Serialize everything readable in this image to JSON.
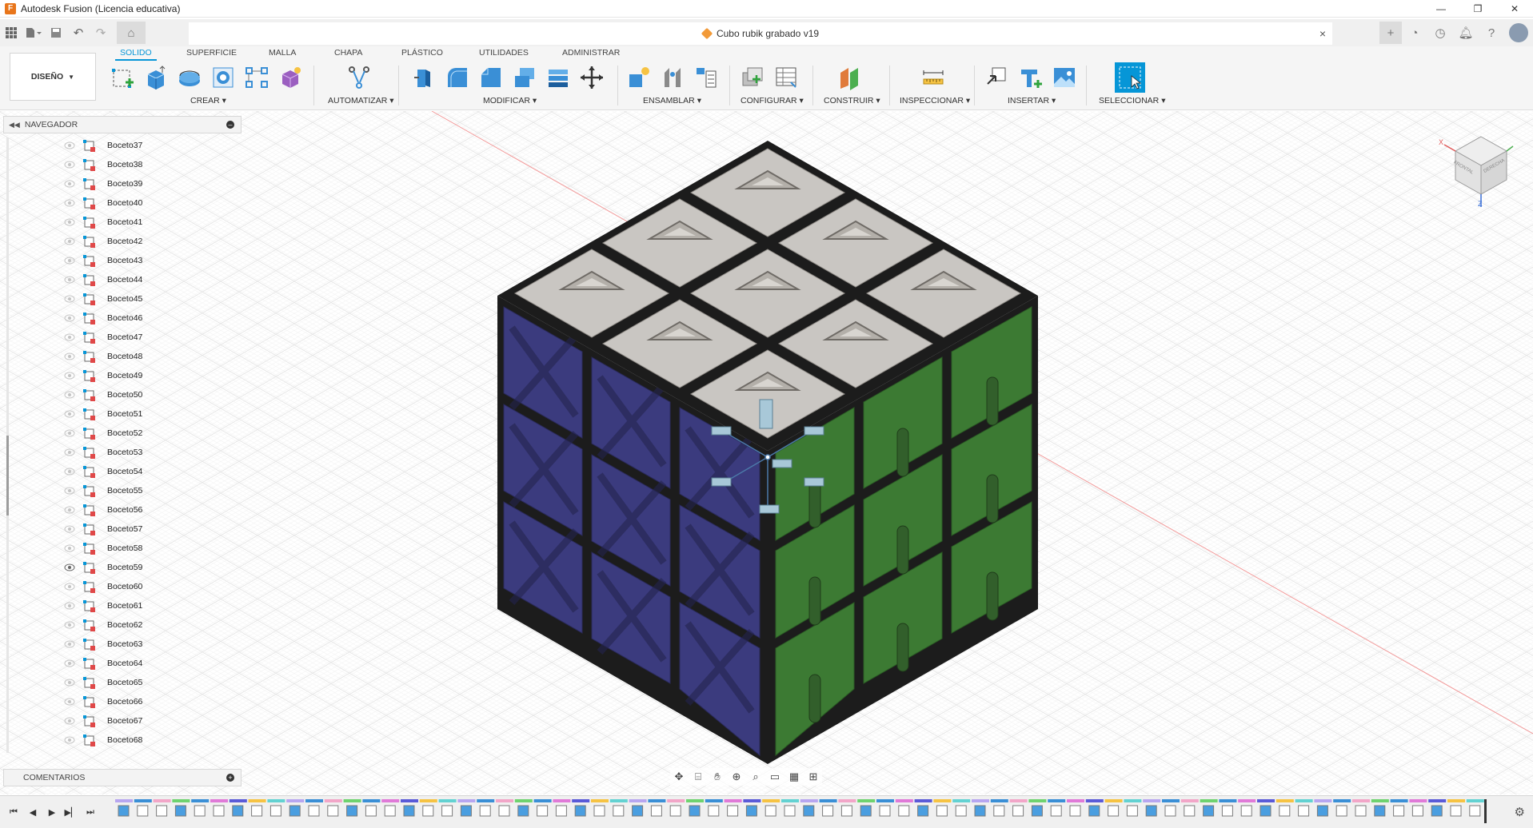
{
  "app": {
    "title": "Autodesk Fusion (Licencia educativa)",
    "logo_letter": "F"
  },
  "window_controls": {
    "minimize": "—",
    "restore": "❐",
    "close": "✕"
  },
  "document": {
    "title": "Cubo rubik grabado v19",
    "close": "×"
  },
  "ribbon": {
    "workspace": "DISEÑO",
    "tabs": [
      {
        "label": "SOLIDO"
      },
      {
        "label": "SUPERFICIE"
      },
      {
        "label": "MALLA"
      },
      {
        "label": "CHAPA"
      },
      {
        "label": "PLÁSTICO"
      },
      {
        "label": "UTILIDADES"
      },
      {
        "label": "ADMINISTRAR"
      }
    ],
    "groups": [
      {
        "label": "CREAR"
      },
      {
        "label": "AUTOMATIZAR"
      },
      {
        "label": "MODIFICAR"
      },
      {
        "label": "ENSAMBLAR"
      },
      {
        "label": "CONFIGURAR"
      },
      {
        "label": "CONSTRUIR"
      },
      {
        "label": "INSPECCIONAR"
      },
      {
        "label": "INSERTAR"
      },
      {
        "label": "SELECCIONAR"
      }
    ],
    "accent": "#0696d7"
  },
  "browser": {
    "title": "NAVEGADOR",
    "items": [
      {
        "label": "Boceto37",
        "visible": false
      },
      {
        "label": "Boceto38",
        "visible": false
      },
      {
        "label": "Boceto39",
        "visible": false
      },
      {
        "label": "Boceto40",
        "visible": false
      },
      {
        "label": "Boceto41",
        "visible": false
      },
      {
        "label": "Boceto42",
        "visible": false
      },
      {
        "label": "Boceto43",
        "visible": false
      },
      {
        "label": "Boceto44",
        "visible": false
      },
      {
        "label": "Boceto45",
        "visible": false
      },
      {
        "label": "Boceto46",
        "visible": false
      },
      {
        "label": "Boceto47",
        "visible": false
      },
      {
        "label": "Boceto48",
        "visible": false
      },
      {
        "label": "Boceto49",
        "visible": false
      },
      {
        "label": "Boceto50",
        "visible": false
      },
      {
        "label": "Boceto51",
        "visible": false
      },
      {
        "label": "Boceto52",
        "visible": false
      },
      {
        "label": "Boceto53",
        "visible": false
      },
      {
        "label": "Boceto54",
        "visible": false
      },
      {
        "label": "Boceto55",
        "visible": false
      },
      {
        "label": "Boceto56",
        "visible": false
      },
      {
        "label": "Boceto57",
        "visible": false
      },
      {
        "label": "Boceto58",
        "visible": false
      },
      {
        "label": "Boceto59",
        "visible": true
      },
      {
        "label": "Boceto60",
        "visible": false
      },
      {
        "label": "Boceto61",
        "visible": false
      },
      {
        "label": "Boceto62",
        "visible": false
      },
      {
        "label": "Boceto63",
        "visible": false
      },
      {
        "label": "Boceto64",
        "visible": false
      },
      {
        "label": "Boceto65",
        "visible": false
      },
      {
        "label": "Boceto66",
        "visible": false
      },
      {
        "label": "Boceto67",
        "visible": false
      },
      {
        "label": "Boceto68",
        "visible": false
      }
    ]
  },
  "comments": {
    "title": "COMENTARIOS"
  },
  "viewcube": {
    "x_label": "X",
    "z_label": "Z",
    "front_face": "FRONTAL",
    "side_face": "DERECHA"
  },
  "colors": {
    "cube_left": "#3b3b7e",
    "cube_right": "#3c7a33",
    "cube_top": "#c9c6c2",
    "frame": "#1c1c1c"
  }
}
